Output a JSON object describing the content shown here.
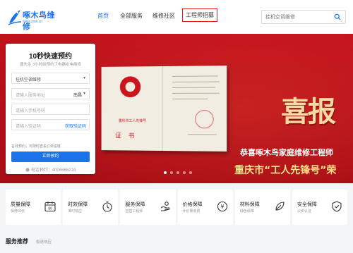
{
  "header": {
    "logo_name": "啄木鸟维修",
    "logo_url": "www.zmn.cn",
    "nav": [
      {
        "label": "首页",
        "active": true
      },
      {
        "label": "全部服务"
      },
      {
        "label": "维修社区"
      },
      {
        "label": "工程师招募",
        "highlighted": true
      }
    ],
    "search_placeholder": "挂机空调维修"
  },
  "banner": {
    "headline": "喜报",
    "line1": "恭喜啄木鸟家庭维修工程师",
    "line2": "重庆市“工人先锋号”荣",
    "certificate_title": "重庆市工人先锋号",
    "certificate_word": "证书",
    "slide_count": 5,
    "active_slide": 0
  },
  "booking": {
    "title": "10秒快速预约",
    "subtitle": "唐先生 3小时前预约了电器水电维修",
    "service_select": "挂机空调维修",
    "address_placeholder": "请输入服务地址",
    "city": "南昌",
    "phone_placeholder": "请输入手机号码",
    "code_placeholder": "请输入验证码",
    "get_code": "获取验证码",
    "tip": "在线预约，可随时查看订单进度",
    "submit": "立即预约",
    "hotline": "电话预约：4006666218"
  },
  "guarantees": [
    {
      "title": "质量保障",
      "sub": "保修90天",
      "icon": "calendar-90-icon"
    },
    {
      "title": "时效保障",
      "sub": "准时响应",
      "icon": "stopwatch-icon"
    },
    {
      "title": "服务保障",
      "sub": "自营工程师",
      "icon": "service-hand-icon"
    },
    {
      "title": "价格保障",
      "sub": "计价量收费",
      "icon": "yen-coin-icon"
    },
    {
      "title": "材料保障",
      "sub": "绿色保障",
      "icon": "leaf-icon"
    },
    {
      "title": "安全保障",
      "sub": "公安认证",
      "icon": "shield-icon"
    }
  ],
  "section": {
    "title": "服务推荐",
    "subtitle": "极速响应"
  },
  "colors": {
    "brand_blue": "#1a73e8",
    "banner_red": "#c1121c",
    "nav_highlight_border": "#e02020"
  }
}
